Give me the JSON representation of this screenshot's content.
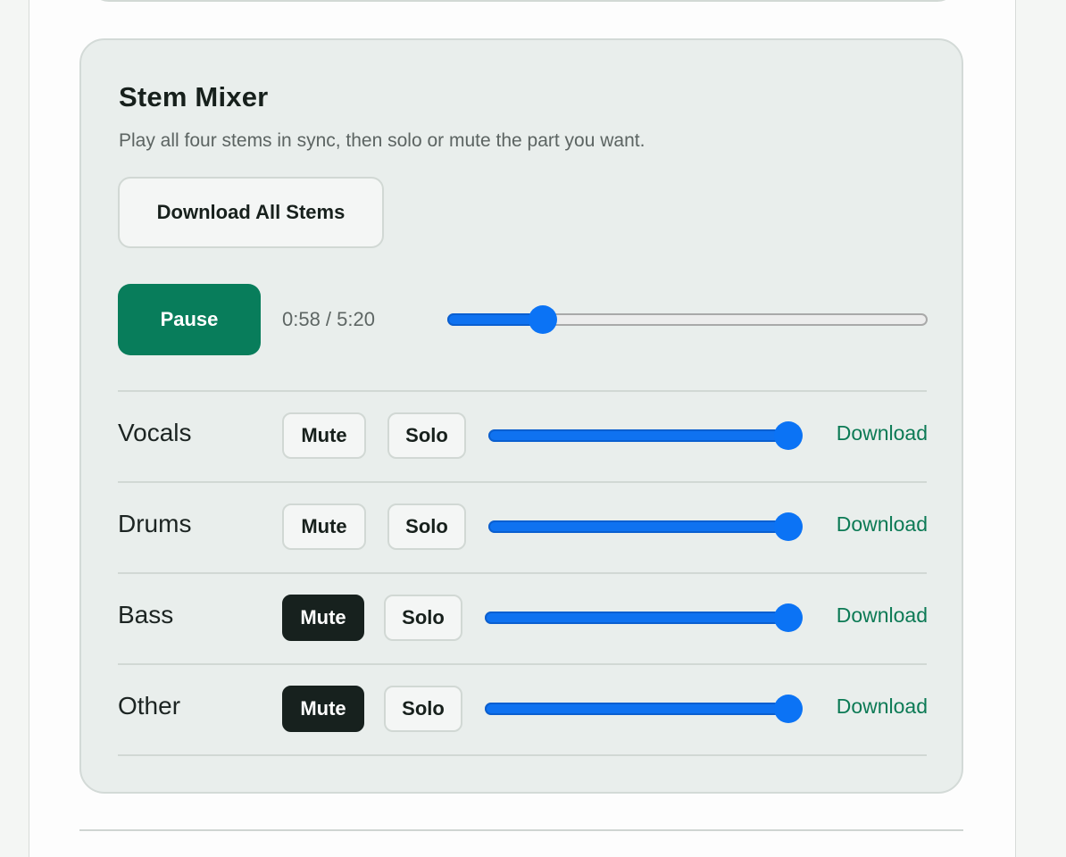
{
  "mixer": {
    "title": "Stem Mixer",
    "subtitle": "Play all four stems in sync, then solo or mute the part you want.",
    "download_all_label": "Download All Stems",
    "pause_label": "Pause",
    "time_display": "0:58 / 5:20",
    "progress_fraction": 0.18
  },
  "stems": [
    {
      "name": "Vocals",
      "mute_label": "Mute",
      "solo_label": "Solo",
      "muted": false,
      "volume_fraction": 1.0,
      "download_label": "Download"
    },
    {
      "name": "Drums",
      "mute_label": "Mute",
      "solo_label": "Solo",
      "muted": false,
      "volume_fraction": 1.0,
      "download_label": "Download"
    },
    {
      "name": "Bass",
      "mute_label": "Mute",
      "solo_label": "Solo",
      "muted": true,
      "volume_fraction": 1.0,
      "download_label": "Download"
    },
    {
      "name": "Other",
      "mute_label": "Mute",
      "solo_label": "Solo",
      "muted": true,
      "volume_fraction": 1.0,
      "download_label": "Download"
    }
  ],
  "colors": {
    "accent_green": "#087d5b",
    "slider_blue": "#0b73f5",
    "mute_active": "#17211e",
    "download_link": "#0c7a55"
  }
}
